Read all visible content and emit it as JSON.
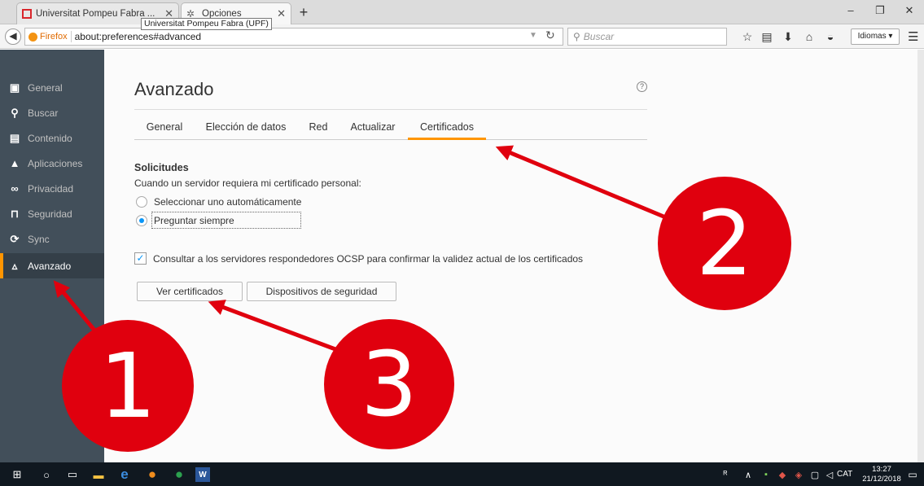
{
  "browser": {
    "tabs": [
      {
        "label": "Universitat Pompeu Fabra ...",
        "icon": "upf-favicon-icon"
      },
      {
        "label": "Opciones",
        "icon": "gear-icon"
      }
    ],
    "tooltip": "Universitat Pompeu Fabra (UPF)",
    "identity_label": "Firefox",
    "url": "about:preferences#advanced",
    "search_placeholder": "Buscar",
    "lang_button": "Idiomas"
  },
  "sidebar": {
    "items": [
      {
        "label": "General",
        "icon": "general-icon"
      },
      {
        "label": "Buscar",
        "icon": "search-icon"
      },
      {
        "label": "Contenido",
        "icon": "document-icon"
      },
      {
        "label": "Aplicaciones",
        "icon": "rocket-icon"
      },
      {
        "label": "Privacidad",
        "icon": "mask-icon"
      },
      {
        "label": "Seguridad",
        "icon": "lock-icon"
      },
      {
        "label": "Sync",
        "icon": "sync-icon"
      },
      {
        "label": "Avanzado",
        "icon": "wizard-hat-icon"
      }
    ],
    "selected": "Avanzado"
  },
  "page": {
    "title": "Avanzado",
    "tabs": [
      "General",
      "Elección de datos",
      "Red",
      "Actualizar",
      "Certificados"
    ],
    "selected_tab": "Certificados",
    "section_heading": "Solicitudes",
    "section_desc": "Cuando un servidor requiera mi certificado personal:",
    "radio_options": [
      {
        "label": "Seleccionar uno automáticamente",
        "checked": false
      },
      {
        "label": "Preguntar siempre",
        "checked": true
      }
    ],
    "ocsp_label": "Consultar a los servidores respondedores OCSP para confirmar la validez actual de los certificados",
    "ocsp_checked": true,
    "buttons": {
      "view_certs": "Ver certificados",
      "security_devices": "Dispositivos de seguridad"
    }
  },
  "annotations": [
    "1",
    "2",
    "3"
  ],
  "taskbar": {
    "language": "CAT",
    "time": "13:27",
    "date": "21/12/2018"
  },
  "colors": {
    "sidebar_bg": "#424f5a",
    "accent": "#ff9500",
    "annotation_red": "#e0000e",
    "radio_blue": "#0996f8"
  }
}
